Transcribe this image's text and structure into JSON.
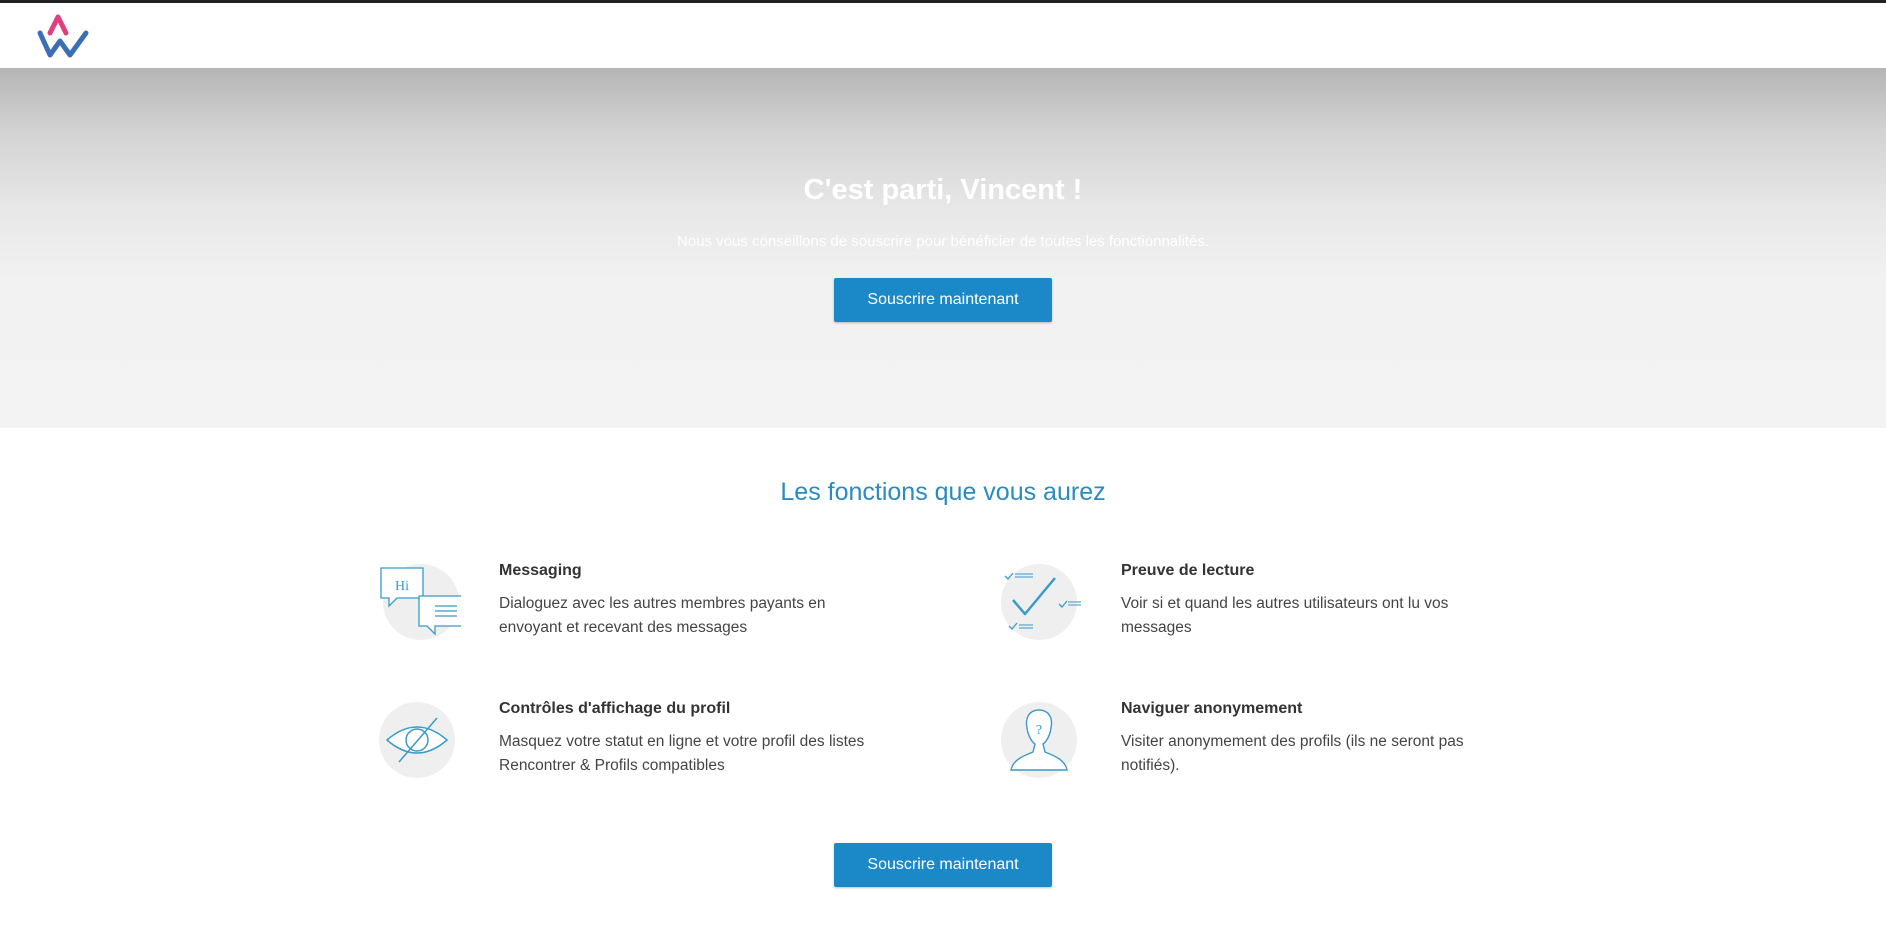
{
  "hero": {
    "title": "C'est parti, Vincent !",
    "subtitle": "Nous vous conseillons de souscrire pour bénéficier de toutes les fonctionnalités.",
    "cta_label": "Souscrire maintenant"
  },
  "features": {
    "title": "Les fonctions que vous aurez",
    "items": [
      {
        "title": "Messaging",
        "description": "Dialoguez avec les autres membres payants en envoyant et recevant des messages",
        "icon": "chat-bubbles-icon",
        "icon_text": "Hi"
      },
      {
        "title": "Preuve de lecture",
        "description": "Voir si et quand les autres utilisateurs ont lu vos messages",
        "icon": "read-receipt-check-icon"
      },
      {
        "title": "Contrôles d'affichage du profil",
        "description": "Masquez votre statut en ligne et votre profil des listes Rencontrer & Profils compatibles",
        "icon": "eye-hidden-icon"
      },
      {
        "title": "Naviguer anonymement",
        "description": "Visiter anonymement des profils (ils ne seront pas notifiés).",
        "icon": "anonymous-person-icon",
        "icon_text": "?"
      }
    ],
    "cta_label": "Souscrire maintenant"
  },
  "colors": {
    "accent": "#1b88c8",
    "title_blue": "#2a8bc0",
    "logo_pink": "#e0407f",
    "logo_blue": "#3b6fb5"
  }
}
